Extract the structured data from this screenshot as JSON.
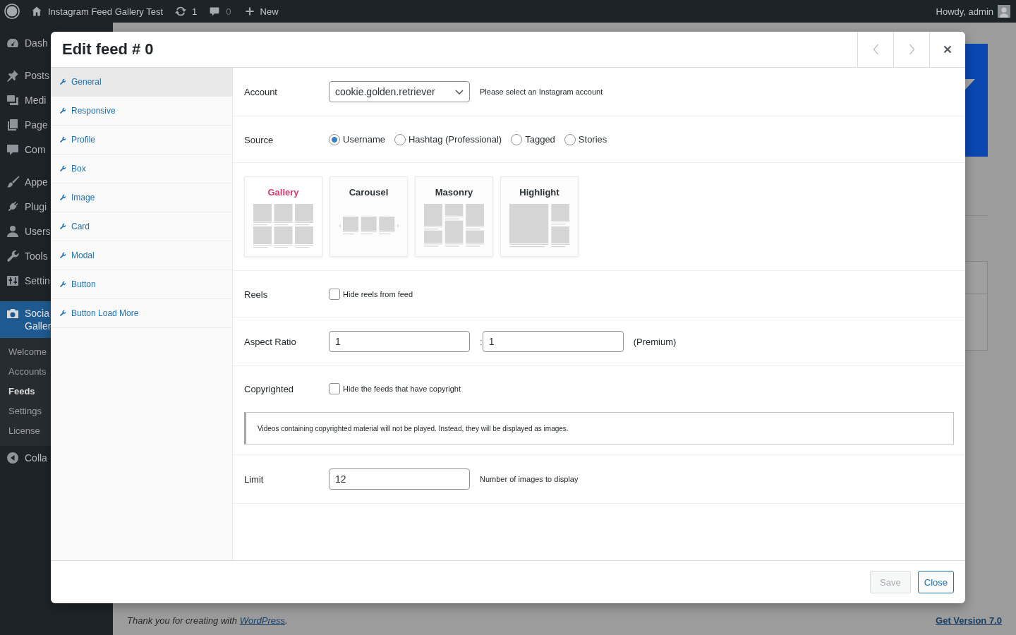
{
  "admin_bar": {
    "site_name": "Instagram Feed Gallery Test",
    "updates": "1",
    "comments": "0",
    "new_label": "New",
    "greeting": "Howdy, admin"
  },
  "admin_menu": {
    "groups": [
      {
        "items": [
          {
            "label": "Dash",
            "selected": false
          }
        ]
      },
      {
        "items": [
          {
            "label": "Posts",
            "selected": false
          },
          {
            "label": "Medi",
            "selected": false
          },
          {
            "label": "Page",
            "selected": false
          },
          {
            "label": "Com",
            "selected": false
          }
        ]
      },
      {
        "items": [
          {
            "label": "Appe",
            "selected": false
          },
          {
            "label": "Plugi",
            "selected": false
          },
          {
            "label": "Users",
            "selected": false
          },
          {
            "label": "Tools",
            "selected": false
          },
          {
            "label": "Settin",
            "selected": false
          }
        ]
      },
      {
        "items": [
          {
            "label": "Socia Galler",
            "selected": true,
            "submenu": [
              {
                "label": "Welcome",
                "selected": false
              },
              {
                "label": "Accounts",
                "selected": false
              },
              {
                "label": "Feeds",
                "selected": true
              },
              {
                "label": "Settings",
                "selected": false
              },
              {
                "label": "License",
                "selected": false
              }
            ]
          }
        ]
      }
    ],
    "collapse": "Colla"
  },
  "page": {
    "credit": {
      "before": "Thank you for creating with ",
      "link": "WordPress",
      "after": "."
    },
    "version_link": "Get Version 7.0"
  },
  "modal": {
    "title": "Edit feed # 0",
    "header_buttons": [
      {
        "kind": "previous",
        "disabled": true
      },
      {
        "kind": "next",
        "disabled": true
      },
      {
        "kind": "close",
        "disabled": false
      }
    ],
    "tabs": [
      {
        "label": "General",
        "selected": true
      },
      {
        "label": "Responsive",
        "selected": false
      },
      {
        "label": "Profile",
        "selected": false
      },
      {
        "label": "Box",
        "selected": false
      },
      {
        "label": "Image",
        "selected": false
      },
      {
        "label": "Card",
        "selected": false
      },
      {
        "label": "Modal",
        "selected": false
      },
      {
        "label": "Button",
        "selected": false
      },
      {
        "label": "Button Load More",
        "selected": false
      }
    ],
    "rows": [
      {
        "kind": "select",
        "label": "Account",
        "value": "cookie.golden.retriever",
        "help": "Please select an Instagram account"
      },
      {
        "kind": "radios",
        "label": "Source",
        "options": [
          {
            "label": "Username",
            "selected": true
          },
          {
            "label": "Hashtag (Professional)",
            "selected": false
          },
          {
            "label": "Tagged",
            "selected": false
          },
          {
            "label": "Stories",
            "selected": false
          }
        ]
      },
      {
        "kind": "layouts",
        "options": [
          {
            "kind": "gallery",
            "label": "Gallery",
            "selected": true
          },
          {
            "kind": "carousel",
            "label": "Carousel",
            "selected": false
          },
          {
            "kind": "masonry",
            "label": "Masonry",
            "selected": false
          },
          {
            "kind": "highlight",
            "label": "Highlight",
            "selected": false
          }
        ]
      },
      {
        "kind": "checkbox",
        "label": "Reels",
        "text": "Hide reels from feed",
        "checked": false
      },
      {
        "kind": "ratio",
        "label": "Aspect Ratio",
        "values": [
          "1",
          "1"
        ],
        "separator": ":",
        "note": "(Premium)"
      },
      {
        "kind": "checkbox",
        "label": "Copyrighted",
        "text": "Hide the feeds that have copyright",
        "checked": false,
        "notice": "Videos containing copyrighted material will not be played. Instead, they will be displayed as images."
      },
      {
        "kind": "input",
        "label": "Limit",
        "value": "12",
        "help": "Number of images to display"
      }
    ],
    "footer_buttons": [
      {
        "label": "Save",
        "disabled": true
      },
      {
        "label": "Close",
        "disabled": false
      }
    ]
  }
}
